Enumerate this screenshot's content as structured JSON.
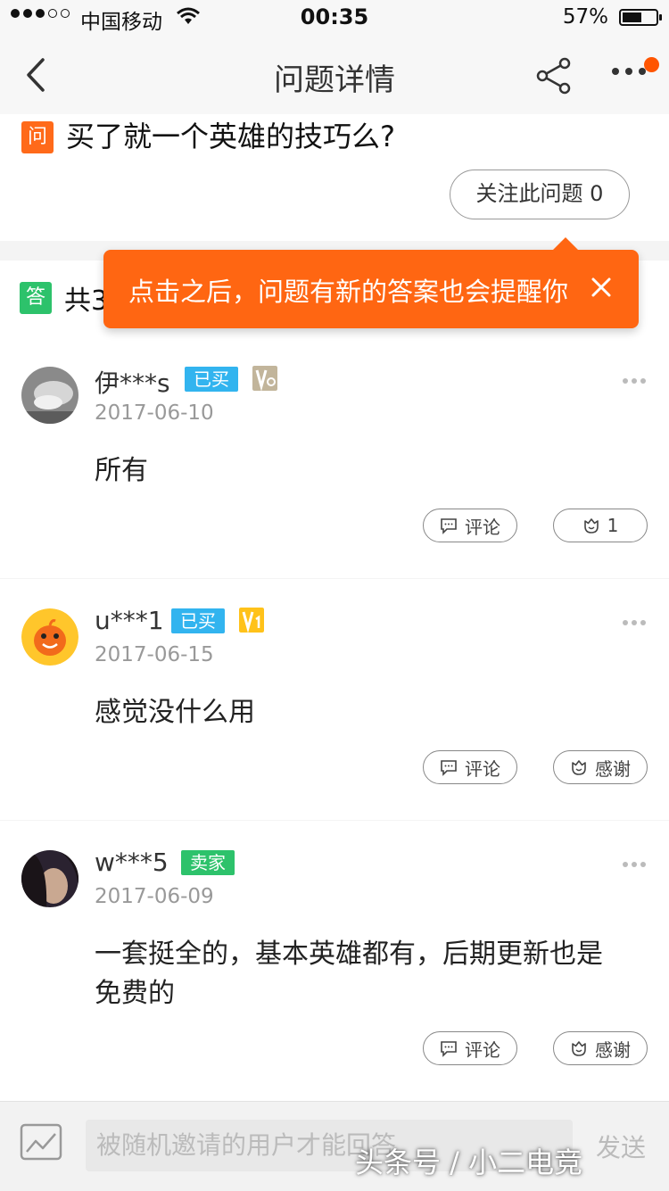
{
  "status_bar": {
    "carrier": "中国移动",
    "time": "00:35",
    "battery": "57%",
    "battery_level": 0.57
  },
  "nav": {
    "title": "问题详情"
  },
  "question": {
    "badge": "问",
    "text": "买了就一个英雄的技巧么?",
    "follow_label": "关注此问题 0"
  },
  "answers_header": {
    "badge": "答",
    "count_text": "共3"
  },
  "tooltip": {
    "text": "点击之后，问题有新的答案也会提醒你"
  },
  "answers": [
    {
      "username": "伊***s",
      "tag": "已买",
      "tag_color": "#32b4ef",
      "level": "V0",
      "date": "2017-06-10",
      "content": "所有",
      "comment_label": "评论",
      "thanks_label": "1"
    },
    {
      "username": "u***1",
      "tag": "已买",
      "tag_color": "#32b4ef",
      "level": "V1",
      "date": "2017-06-15",
      "content": "感觉没什么用",
      "comment_label": "评论",
      "thanks_label": "感谢"
    },
    {
      "username": "w***5",
      "tag": "卖家",
      "tag_color": "#2dc26b",
      "date": "2017-06-09",
      "content": "一套挺全的，基本英雄都有，后期更新也是免费的",
      "comment_label": "评论",
      "thanks_label": "感谢"
    }
  ],
  "bottom_bar": {
    "placeholder": "被随机邀请的用户才能回答",
    "send_label": "发送"
  },
  "watermark": "头条号 / 小二电竞",
  "colors": {
    "accent_orange": "#ff6612",
    "green": "#2dc26b",
    "blue_tag": "#32b4ef"
  }
}
